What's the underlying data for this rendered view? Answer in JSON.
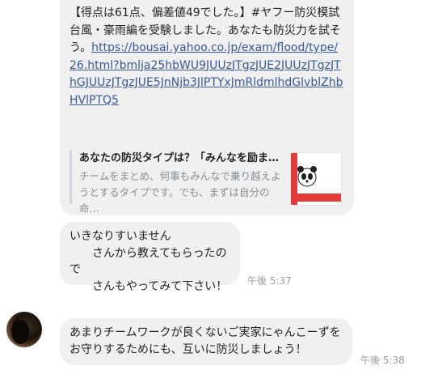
{
  "message1": {
    "text": "【得点は61点、偏差値49でした。】#ヤフー防災模試 台風・豪雨編を受験しました。あなたも防災力を試そう。",
    "link": "https://bousai.yahoo.co.jp/exam/flood/type/26.html?bmlja25hbWU9JUUzJTgzJUE2JUUzJTgzJThGJUUzJTgzJUE5JnNjb3JlPTYxJmRldmlhdGlvblZhbHVlPTQ5",
    "preview_title": "あなたの防災タイプは？「みんなを励ま…",
    "preview_desc": "チームをまとめ、何事もみんなで乗り越えようとするタイプです。でも、まずは自分の命…"
  },
  "message2": {
    "text": "いきなりすいません\n　　さんから教えてもらったので\n　　さんもやってみて下さい！",
    "time": "午後 5:37"
  },
  "message3": {
    "text": "あまりチームワークが良くないご実家にゃんこーずをお守りするためにも、互いに防災しましょう！",
    "time": "午後 5:38"
  }
}
